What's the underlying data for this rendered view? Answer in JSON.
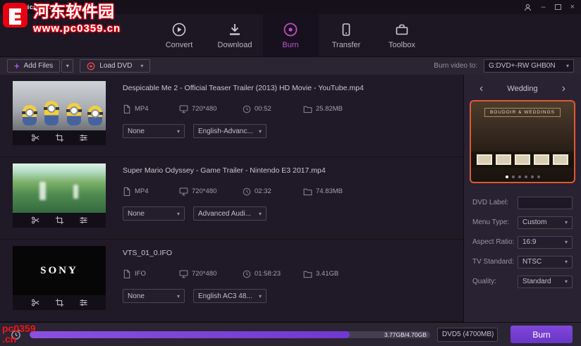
{
  "app": {
    "title": "uniconverter"
  },
  "colors": {
    "accent_purple": "#7d44d6",
    "accent_pink": "#c24cc0",
    "record_red": "#e5484d",
    "template_highlight": "#df5930",
    "watermark_red": "#e60012"
  },
  "icons": {
    "convert_icon": "play-circle",
    "download_icon": "download-arrow",
    "burn_icon": "disc",
    "transfer_icon": "phone",
    "toolbox_icon": "briefcase",
    "plus": "+",
    "record_icon": "record-circle",
    "caret_down": "▾",
    "chevron_left": "‹",
    "chevron_right": "›",
    "minimize": "–",
    "close": "×",
    "trim_icon": "scissors",
    "crop_icon": "crop",
    "effects_icon": "sliders",
    "format_icon": "file",
    "resolution_icon": "monitor",
    "duration_icon": "clock",
    "size_icon": "folder",
    "schedule_icon": "alarm-clock",
    "account_icon": "person"
  },
  "nav": {
    "tabs": [
      {
        "label": "Convert",
        "active": false
      },
      {
        "label": "Download",
        "active": false
      },
      {
        "label": "Burn",
        "active": true
      },
      {
        "label": "Transfer",
        "active": false
      },
      {
        "label": "Toolbox",
        "active": false
      }
    ]
  },
  "toolbar": {
    "add_files_label": "Add Files",
    "load_dvd_label": "Load DVD",
    "burn_to_label": "Burn video to:",
    "burn_to_value": "G:DVD+-RW GHB0N"
  },
  "files": [
    {
      "title": "Despicable Me 2 - Official Teaser Trailer (2013) HD Movie - YouTube.mp4",
      "format": "MP4",
      "resolution": "720*480",
      "duration": "00:52",
      "size": "25.82MB",
      "menu_option": "None",
      "audio_option": "English-Advanc..."
    },
    {
      "title": "Super Mario Odyssey - Game Trailer - Nintendo E3 2017.mp4",
      "format": "MP4",
      "resolution": "720*480",
      "duration": "02:32",
      "size": "74.83MB",
      "menu_option": "None",
      "audio_option": "Advanced Audi..."
    },
    {
      "title": "VTS_01_0.IFO",
      "format": "IFO",
      "resolution": "720*480",
      "duration": "01:58:23",
      "size": "3.41GB",
      "menu_option": "None",
      "audio_option": "English AC3 48...",
      "thumb_text": "SONY"
    }
  ],
  "template_panel": {
    "name": "Wedding",
    "preview_title": "BOUDOIR & WEDDINGS",
    "fields": [
      {
        "label": "DVD Label:",
        "value": "",
        "type": "input"
      },
      {
        "label": "Menu Type:",
        "value": "Custom",
        "type": "select"
      },
      {
        "label": "Aspect Ratio:",
        "value": "16:9",
        "type": "select"
      },
      {
        "label": "TV Standard:",
        "value": "NTSC",
        "type": "select"
      },
      {
        "label": "Quality:",
        "value": "Standard",
        "type": "select"
      }
    ]
  },
  "footer": {
    "progress_text": "3.77GB/4.70GB",
    "progress_percent": 80,
    "disc_type": "DVD5 (4700MB)",
    "burn_label": "Burn"
  },
  "watermark": {
    "site_name": "河东软件园",
    "site_url": "www.pc0359.cn",
    "corner_line1": "pc0359",
    "corner_line2": ".cn"
  }
}
